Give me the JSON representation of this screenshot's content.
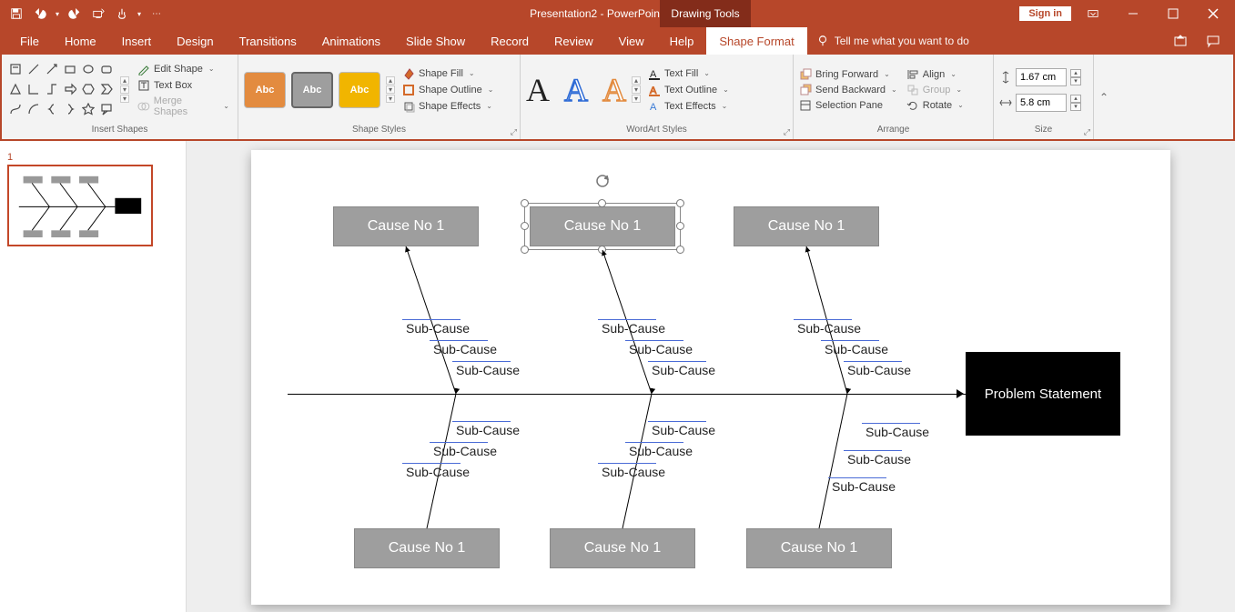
{
  "app": {
    "doc_name": "Presentation2",
    "app_name": "PowerPoint",
    "tool_tab": "Drawing Tools",
    "sign_in": "Sign in"
  },
  "tabs": {
    "file": "File",
    "home": "Home",
    "insert": "Insert",
    "design": "Design",
    "transitions": "Transitions",
    "animations": "Animations",
    "slideshow": "Slide Show",
    "record": "Record",
    "review": "Review",
    "view": "View",
    "help": "Help",
    "shape_format": "Shape Format",
    "tellme": "Tell me what you want to do"
  },
  "ribbon": {
    "insert_shapes": {
      "label": "Insert Shapes",
      "edit_shape": "Edit Shape",
      "text_box": "Text Box",
      "merge": "Merge Shapes"
    },
    "shape_styles": {
      "label": "Shape Styles",
      "abc": "Abc",
      "fill": "Shape Fill",
      "outline": "Shape Outline",
      "effects": "Shape Effects"
    },
    "wordart": {
      "label": "WordArt Styles",
      "text_fill": "Text Fill",
      "text_outline": "Text Outline",
      "text_effects": "Text Effects"
    },
    "arrange": {
      "label": "Arrange",
      "bring_forward": "Bring Forward",
      "send_backward": "Send Backward",
      "selection_pane": "Selection Pane",
      "align": "Align",
      "group": "Group",
      "rotate": "Rotate"
    },
    "size": {
      "label": "Size",
      "height": "1.67 cm",
      "width": "5.8 cm"
    }
  },
  "slide_num": "1",
  "fishbone": {
    "problem": "Problem Statement",
    "top": [
      "Cause No 1",
      "Cause No 1",
      "Cause No 1"
    ],
    "bottom": [
      "Cause No 1",
      "Cause No 1",
      "Cause No 1"
    ],
    "sub": "Sub-Cause"
  }
}
